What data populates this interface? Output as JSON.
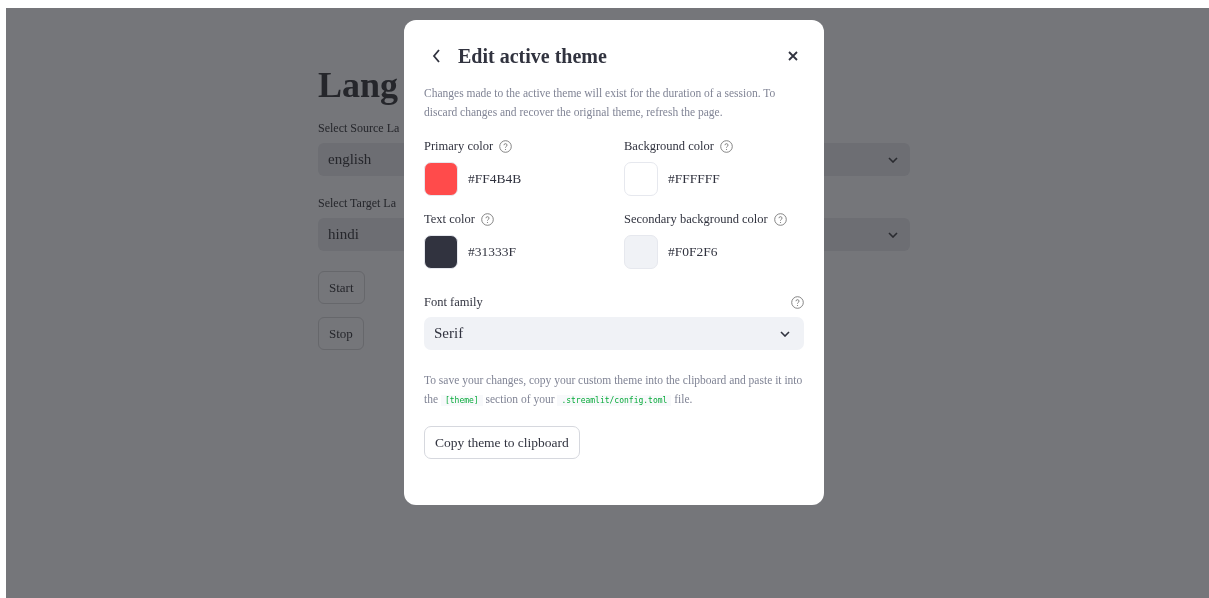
{
  "page": {
    "title": "Lang",
    "fields": [
      {
        "label": "Select Source La",
        "value": "english"
      },
      {
        "label": "Select Target La",
        "value": "hindi"
      }
    ],
    "buttons": [
      "Start",
      "Stop"
    ]
  },
  "dialog": {
    "title": "Edit active theme",
    "description": "Changes made to the active theme will exist for the duration of a session. To discard changes and recover the original theme, refresh the page.",
    "colors": [
      {
        "label": "Primary color",
        "value": "#FF4B4B",
        "color": "#ff4b4b"
      },
      {
        "label": "Background color",
        "value": "#FFFFFF",
        "color": "#ffffff"
      },
      {
        "label": "Text color",
        "value": "#31333F",
        "color": "#31333f"
      },
      {
        "label": "Secondary background color",
        "value": "#F0F2F6",
        "color": "#f0f2f6"
      }
    ],
    "font_family": {
      "label": "Font family",
      "value": "Serif"
    },
    "note": [
      {
        "kind": "text",
        "text": "To save your changes, copy your custom theme into the clipboard and paste it into the "
      },
      {
        "kind": "code",
        "text": "[theme]"
      },
      {
        "kind": "text",
        "text": " section of your "
      },
      {
        "kind": "code",
        "text": ".streamlit/config.toml"
      },
      {
        "kind": "text",
        "text": " file."
      }
    ],
    "copy_button": "Copy theme to clipboard"
  }
}
